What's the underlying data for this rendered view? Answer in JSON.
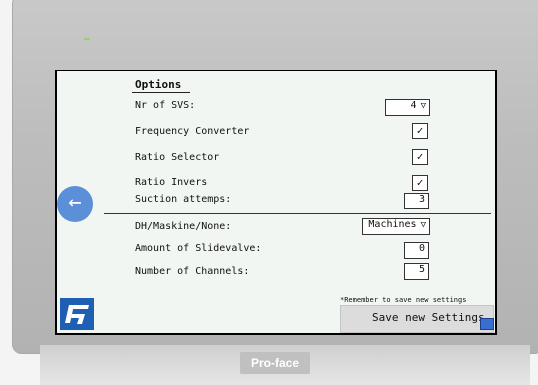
{
  "device": {
    "brand": "Pro-face"
  },
  "options": {
    "title": "Options",
    "rows": [
      {
        "label": "Nr of SVS:",
        "value": "4",
        "arrow": "▽"
      },
      {
        "label": "Frequency Converter",
        "checked": "✓"
      },
      {
        "label": "Ratio Selector",
        "checked": "✓"
      },
      {
        "label": "Ratio Invers",
        "checked": "✓"
      },
      {
        "label": "Suction attemps:",
        "value": "3"
      },
      {
        "label": "DH/Maskine/None:",
        "value": "Machines",
        "arrow": "▽"
      },
      {
        "label": "Amount of Slidevalve:",
        "value": "0"
      },
      {
        "label": "Number of Channels:",
        "value": "5"
      }
    ]
  },
  "footer": {
    "note": "*Remember to save new settings",
    "save_label": "Save new Settings"
  },
  "icons": {
    "back": "arrow-left-icon",
    "logo": "company-logo",
    "save": "save-icon"
  },
  "colors": {
    "panel": "#f1f6f3",
    "back_button": "#5b8fd8",
    "logo": "#1f5fb3",
    "save_button": "#dcdcdc"
  }
}
